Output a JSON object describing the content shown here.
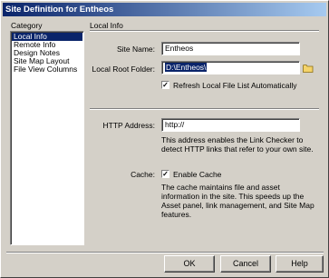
{
  "window": {
    "title": "Site Definition for Entheos"
  },
  "category": {
    "label": "Category",
    "items": [
      "Local Info",
      "Remote Info",
      "Design Notes",
      "Site Map Layout",
      "File View Columns"
    ],
    "selected_index": 0
  },
  "local_info": {
    "section_title": "Local Info",
    "site_name_label": "Site Name:",
    "site_name_value": "Entheos",
    "root_folder_label": "Local Root Folder:",
    "root_folder_value": "D:\\Entheos\\",
    "refresh_label": "Refresh Local File List Automatically",
    "refresh_checked": true,
    "http_label": "HTTP Address:",
    "http_value": "http://",
    "http_desc": "This address enables the Link Checker to detect HTTP links that refer to your own site.",
    "cache_label": "Cache:",
    "cache_checkbox_label": "Enable Cache",
    "cache_checked": true,
    "cache_desc": "The cache maintains file and asset information in the site.  This speeds up the Asset panel, link management, and Site Map features."
  },
  "buttons": {
    "ok": "OK",
    "cancel": "Cancel",
    "help": "Help"
  },
  "icons": {
    "folder": "folder-icon",
    "check": "checkmark-icon"
  },
  "colors": {
    "selection": "#0a246a",
    "dialog_bg": "#d4d0c8"
  }
}
